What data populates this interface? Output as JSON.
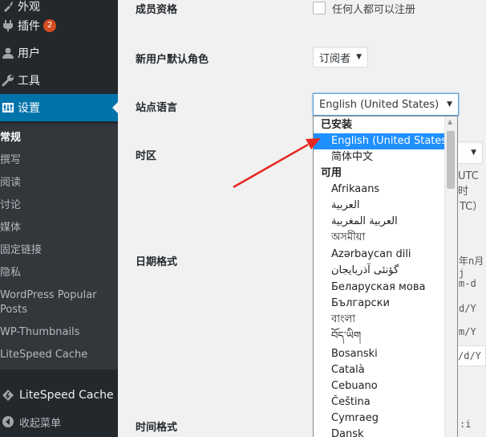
{
  "sidebar": {
    "items": [
      {
        "label": "外观",
        "icon": "brush-icon"
      },
      {
        "label": "插件",
        "icon": "plugin-icon",
        "badge": "2"
      },
      {
        "label": "用户",
        "icon": "user-icon"
      },
      {
        "label": "工具",
        "icon": "wrench-icon"
      },
      {
        "label": "设置",
        "icon": "settings-icon",
        "active": true
      }
    ],
    "submenu": [
      {
        "label": "常规",
        "current": true
      },
      {
        "label": "撰写"
      },
      {
        "label": "阅读"
      },
      {
        "label": "讨论"
      },
      {
        "label": "媒体"
      },
      {
        "label": "固定链接"
      },
      {
        "label": "隐私"
      },
      {
        "label": "WordPress Popular Posts"
      },
      {
        "label": "WP-Thumbnails"
      },
      {
        "label": "LiteSpeed Cache"
      }
    ],
    "litespeed": {
      "label": "LiteSpeed Cache",
      "icon": "litespeed-icon"
    },
    "collapse": {
      "label": "收起菜单",
      "icon": "collapse-icon"
    }
  },
  "settings": {
    "membership": {
      "label": "成员资格",
      "checkbox_label": "任何人都可以注册"
    },
    "default_role": {
      "label": "新用户默认角色",
      "value": "订阅者"
    },
    "site_language": {
      "label": "站点语言",
      "value": "English (United States)"
    },
    "timezone": {
      "label": "时区",
      "partial_text": "UTC时",
      "partial_text2": "TC）"
    },
    "date_format": {
      "label": "日期格式",
      "partials": [
        "年n月j",
        "m-d",
        "d/Y",
        "m/Y",
        "/d/Y"
      ]
    },
    "time_format": {
      "label": "时间格式",
      "partial": ":i"
    }
  },
  "language_dropdown": {
    "installed_label": "已安装",
    "installed": [
      "English (United States)",
      "简体中文"
    ],
    "available_label": "可用",
    "available": [
      "Afrikaans",
      "العربية",
      "العربية المغربية",
      "অসমীয়া",
      "Azərbaycan dili",
      "گؤنئی آذربایجان",
      "Беларуская мова",
      "Български",
      "বাংলা",
      "བོད་ཡིག",
      "Bosanski",
      "Català",
      "Cebuano",
      "Čeština",
      "Cymraeg",
      "Dansk"
    ],
    "selected": "English (United States)"
  },
  "colors": {
    "sidebar_bg": "#23282d",
    "active_bg": "#0073aa",
    "badge_bg": "#d54e21",
    "highlight": "#1e90ff",
    "annotation_arrow": "#e8261f"
  }
}
